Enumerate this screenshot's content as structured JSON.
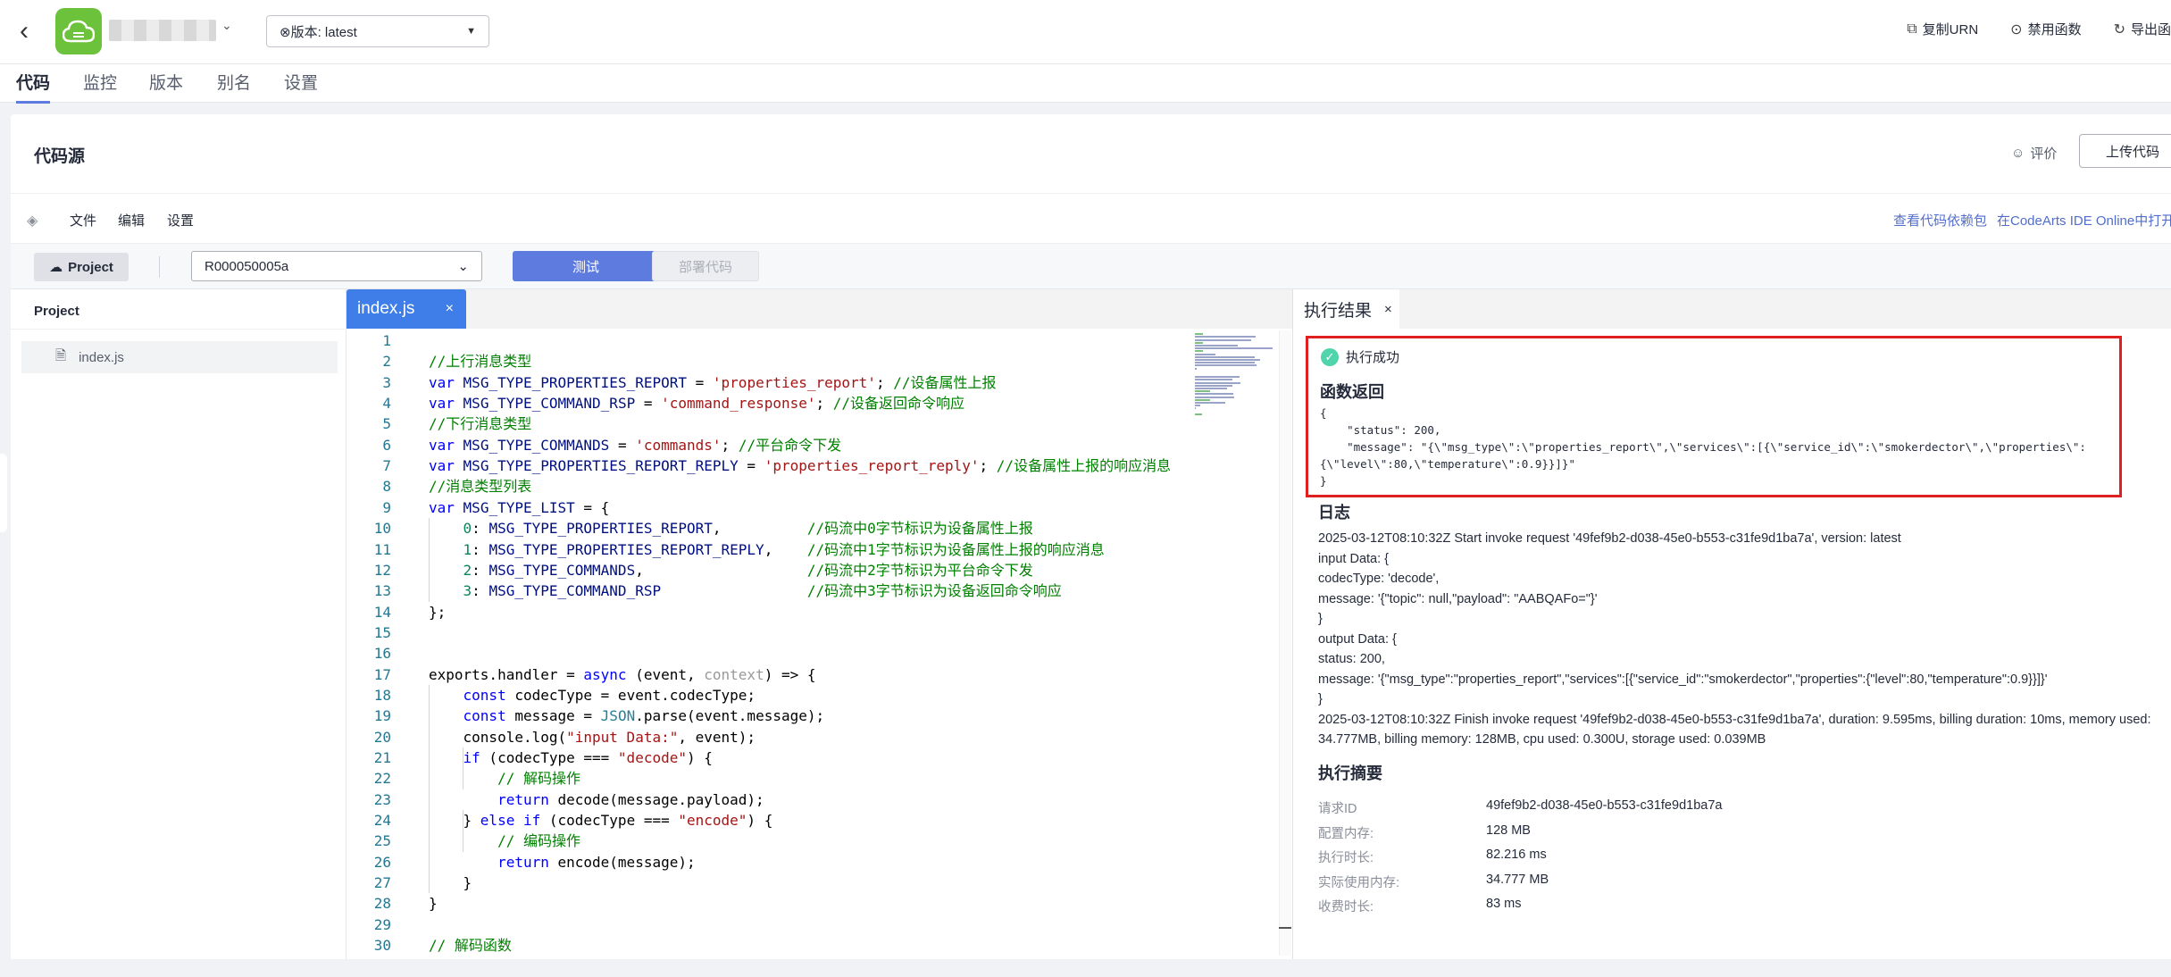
{
  "header": {
    "version_label": "⊗版本: latest",
    "actions": [
      {
        "icon": "copy-icon",
        "label": "复制URN"
      },
      {
        "icon": "disable-icon",
        "label": "禁用函数"
      },
      {
        "icon": "export-icon",
        "label": "导出函"
      }
    ]
  },
  "tabs": [
    "代码",
    "监控",
    "版本",
    "别名",
    "设置"
  ],
  "card": {
    "title": "代码源",
    "rate_label": "评价",
    "upload_label": "上传代码"
  },
  "menubar": {
    "items": [
      "文件",
      "编辑",
      "设置"
    ],
    "links": [
      "查看代码依赖包",
      "在CodeArts IDE Online中打开"
    ]
  },
  "toolbar": {
    "project_label": "Project",
    "project_select": "R000050005a",
    "test_label": "测试",
    "deploy_label": "部署代码"
  },
  "project_panel": {
    "title": "Project",
    "files": [
      "index.js"
    ]
  },
  "editor": {
    "tab": "index.js",
    "lines": [
      "",
      "//上行消息类型",
      "var MSG_TYPE_PROPERTIES_REPORT = 'properties_report'; //设备属性上报",
      "var MSG_TYPE_COMMAND_RSP = 'command_response'; //设备返回命令响应",
      "//下行消息类型",
      "var MSG_TYPE_COMMANDS = 'commands'; //平台命令下发",
      "var MSG_TYPE_PROPERTIES_REPORT_REPLY = 'properties_report_reply'; //设备属性上报的响应消息",
      "//消息类型列表",
      "var MSG_TYPE_LIST = {",
      "    0: MSG_TYPE_PROPERTIES_REPORT,          //码流中0字节标识为设备属性上报",
      "    1: MSG_TYPE_PROPERTIES_REPORT_REPLY,    //码流中1字节标识为设备属性上报的响应消息",
      "    2: MSG_TYPE_COMMANDS,                   //码流中2字节标识为平台命令下发",
      "    3: MSG_TYPE_COMMAND_RSP                 //码流中3字节标识为设备返回命令响应",
      "};",
      "",
      "",
      "exports.handler = async (event, context) => {",
      "    const codecType = event.codecType;",
      "    const message = JSON.parse(event.message);",
      "    console.log(\"input Data:\", event);",
      "    if (codecType === \"decode\") {",
      "        // 解码操作",
      "        return decode(message.payload);",
      "    } else if (codecType === \"encode\") {",
      "        // 编码操作",
      "        return encode(message);",
      "    }",
      "}",
      "",
      "// 解码函数"
    ]
  },
  "result": {
    "tab": "执行结果",
    "status": "执行成功",
    "return_title": "函数返回",
    "return_json": [
      "{",
      "    \"status\": 200,",
      "    \"message\": \"{\\\"msg_type\\\":\\\"properties_report\\\",\\\"services\\\":[{\\\"service_id\\\":\\\"smokerdector\\\",\\\"properties\\\":",
      "{\\\"level\\\":80,\\\"temperature\\\":0.9}}]}\"",
      "}"
    ],
    "log_title": "日志",
    "log_lines": [
      "2025-03-12T08:10:32Z Start invoke request '49fef9b2-d038-45e0-b553-c31fe9d1ba7a', version: latest",
      "input Data: {",
      "codecType: 'decode',",
      "message: '{\"topic\": null,\"payload\": \"AABQAFo=\"}'",
      "}",
      "output Data: {",
      "status: 200,",
      "message: '{\"msg_type\":\"properties_report\",\"services\":[{\"service_id\":\"smokerdector\",\"properties\":{\"level\":80,\"temperature\":0.9}}]}'",
      "}",
      "2025-03-12T08:10:32Z Finish invoke request '49fef9b2-d038-45e0-b553-c31fe9d1ba7a', duration: 9.595ms, billing duration: 10ms, memory used:",
      "34.777MB, billing memory: 128MB, cpu used: 0.300U, storage used: 0.039MB"
    ],
    "summary_title": "执行摘要",
    "summary": [
      {
        "k": "请求ID",
        "v": "49fef9b2-d038-45e0-b553-c31fe9d1ba7a"
      },
      {
        "k": "配置内存:",
        "v": "128 MB"
      },
      {
        "k": "执行时长:",
        "v": "82.216 ms"
      },
      {
        "k": "实际使用内存:",
        "v": "34.777 MB"
      },
      {
        "k": "收费时长:",
        "v": "83 ms"
      }
    ]
  }
}
